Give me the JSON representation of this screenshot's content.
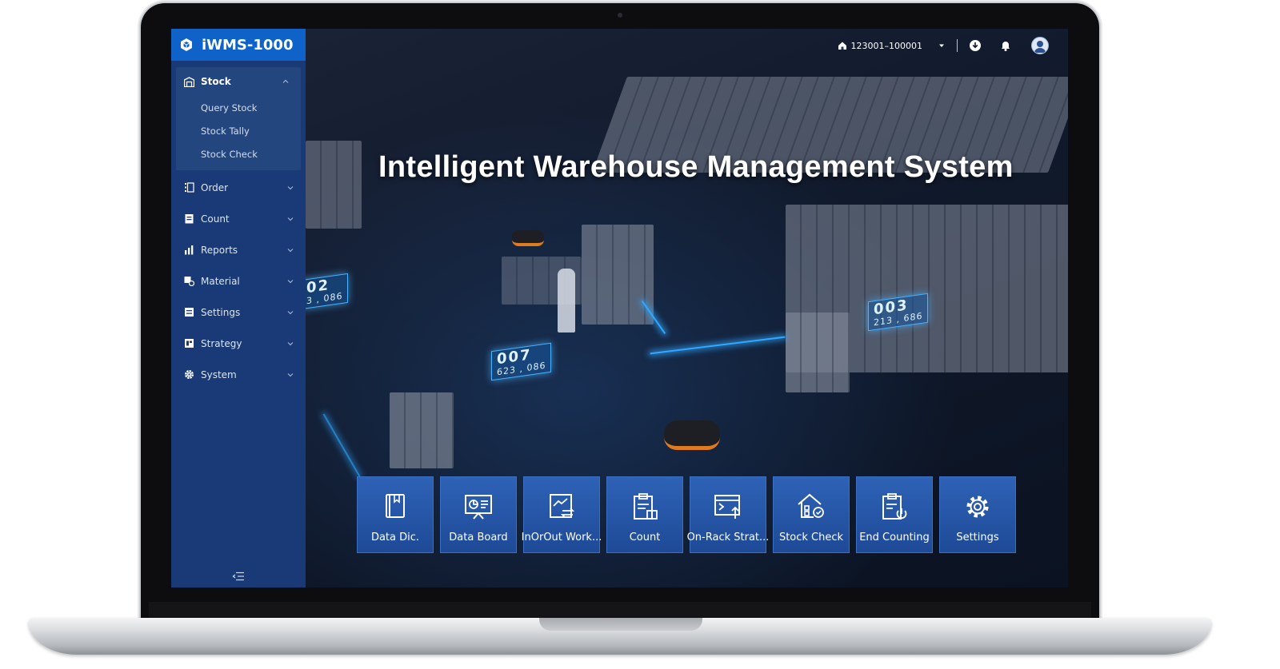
{
  "app": {
    "logo_text": "iWMS-1000",
    "title": "Intelligent Warehouse Management System"
  },
  "topbar": {
    "warehouse": "123001–100001"
  },
  "sidebar": {
    "groups": [
      {
        "label": "Stock",
        "expanded": true,
        "children": [
          "Query Stock",
          "Stock Tally",
          "Stock Check"
        ]
      },
      {
        "label": "Order"
      },
      {
        "label": "Count"
      },
      {
        "label": "Reports"
      },
      {
        "label": "Material"
      },
      {
        "label": "Settings"
      },
      {
        "label": "Strategy"
      },
      {
        "label": "System"
      }
    ]
  },
  "scene_labels": [
    {
      "id": "007",
      "value": "623 , 086"
    },
    {
      "id": "003",
      "value": "213 , 686"
    },
    {
      "id": "02",
      "value": "3 , 086"
    }
  ],
  "tiles": [
    {
      "label": "Data Dic.",
      "icon": "book-icon"
    },
    {
      "label": "Data Board",
      "icon": "presentation-board-icon"
    },
    {
      "label": "InOrOut Work...",
      "icon": "inout-chart-icon"
    },
    {
      "label": "Count",
      "icon": "clipboard-count-icon"
    },
    {
      "label": "On-Rack Strat...",
      "icon": "terminal-upload-icon"
    },
    {
      "label": "Stock Check",
      "icon": "house-check-icon"
    },
    {
      "label": "End Counting",
      "icon": "clipboard-power-icon"
    },
    {
      "label": "Settings",
      "icon": "gear-icon"
    }
  ],
  "colors": {
    "sidebar_bg": "#193a76",
    "logo_bg": "#0f62c8",
    "tile_bg": "#2e62b6",
    "accent_glow": "#2fa8ff"
  }
}
